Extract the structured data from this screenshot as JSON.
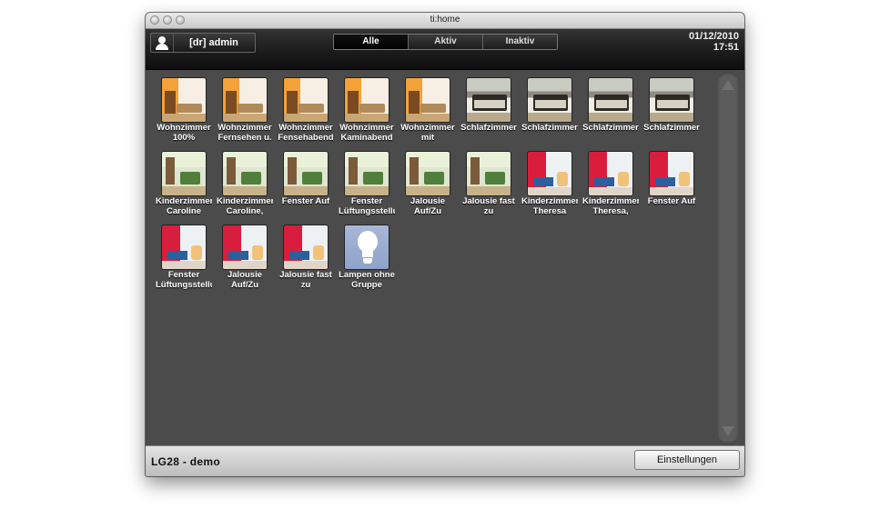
{
  "window": {
    "title": "ti:home"
  },
  "toolbar": {
    "user_label": "[dr] admin",
    "filters": [
      {
        "label": "Alle",
        "active": true
      },
      {
        "label": "Aktiv",
        "active": false
      },
      {
        "label": "Inaktiv",
        "active": false
      }
    ],
    "date": "01/12/2010",
    "time": "17:51"
  },
  "tiles": [
    {
      "line1": "Wohnzimmer",
      "line2": "100%",
      "icon": "living-room-thumb"
    },
    {
      "line1": "Wohnzimmer",
      "line2": "Fernsehen u.",
      "icon": "living-room-thumb"
    },
    {
      "line1": "Wohnzimmer",
      "line2": "Fensehabend",
      "icon": "living-room-thumb"
    },
    {
      "line1": "Wohnzimmer",
      "line2": "Kaminabend",
      "icon": "living-room-thumb"
    },
    {
      "line1": "Wohnzimmer",
      "line2": "mit",
      "icon": "living-room-thumb"
    },
    {
      "line1": "Schlafzimmer",
      "line2": "",
      "icon": "bedroom-thumb"
    },
    {
      "line1": "Schlafzimmer",
      "line2": "",
      "icon": "bedroom-thumb"
    },
    {
      "line1": "Schlafzimmer",
      "line2": "",
      "icon": "bedroom-thumb"
    },
    {
      "line1": "Schlafzimmer",
      "line2": "",
      "icon": "bedroom-thumb"
    },
    {
      "line1": "Kinderzimmer",
      "line2": "Caroline",
      "icon": "kids-room-green-thumb"
    },
    {
      "line1": "Kinderzimmer",
      "line2": "Caroline,",
      "icon": "kids-room-green-thumb"
    },
    {
      "line1": "Fenster Auf",
      "line2": "",
      "icon": "kids-room-green-thumb"
    },
    {
      "line1": "Fenster",
      "line2": "Lüftungsstellur",
      "icon": "kids-room-green-thumb"
    },
    {
      "line1": "Jalousie",
      "line2": "Auf/Zu",
      "icon": "kids-room-green-thumb"
    },
    {
      "line1": "Jalousie fast",
      "line2": "zu",
      "icon": "kids-room-green-thumb"
    },
    {
      "line1": "Kinderzimmer",
      "line2": "Theresa",
      "icon": "kids-room-red-thumb"
    },
    {
      "line1": "Kinderzimmer",
      "line2": "Theresa,",
      "icon": "kids-room-red-thumb"
    },
    {
      "line1": "Fenster Auf",
      "line2": "",
      "icon": "kids-room-red-thumb"
    },
    {
      "line1": "Fenster",
      "line2": "Lüftungsstellur",
      "icon": "kids-room-red-thumb"
    },
    {
      "line1": "Jalousie",
      "line2": "Auf/Zu",
      "icon": "kids-room-red-thumb"
    },
    {
      "line1": "Jalousie fast",
      "line2": "zu",
      "icon": "kids-room-red-thumb"
    },
    {
      "line1": "Lampen ohne",
      "line2": "Gruppe",
      "icon": "light-bulb-icon"
    }
  ],
  "footer": {
    "status": "LG28 - demo",
    "settings_label": "Einstellungen"
  }
}
